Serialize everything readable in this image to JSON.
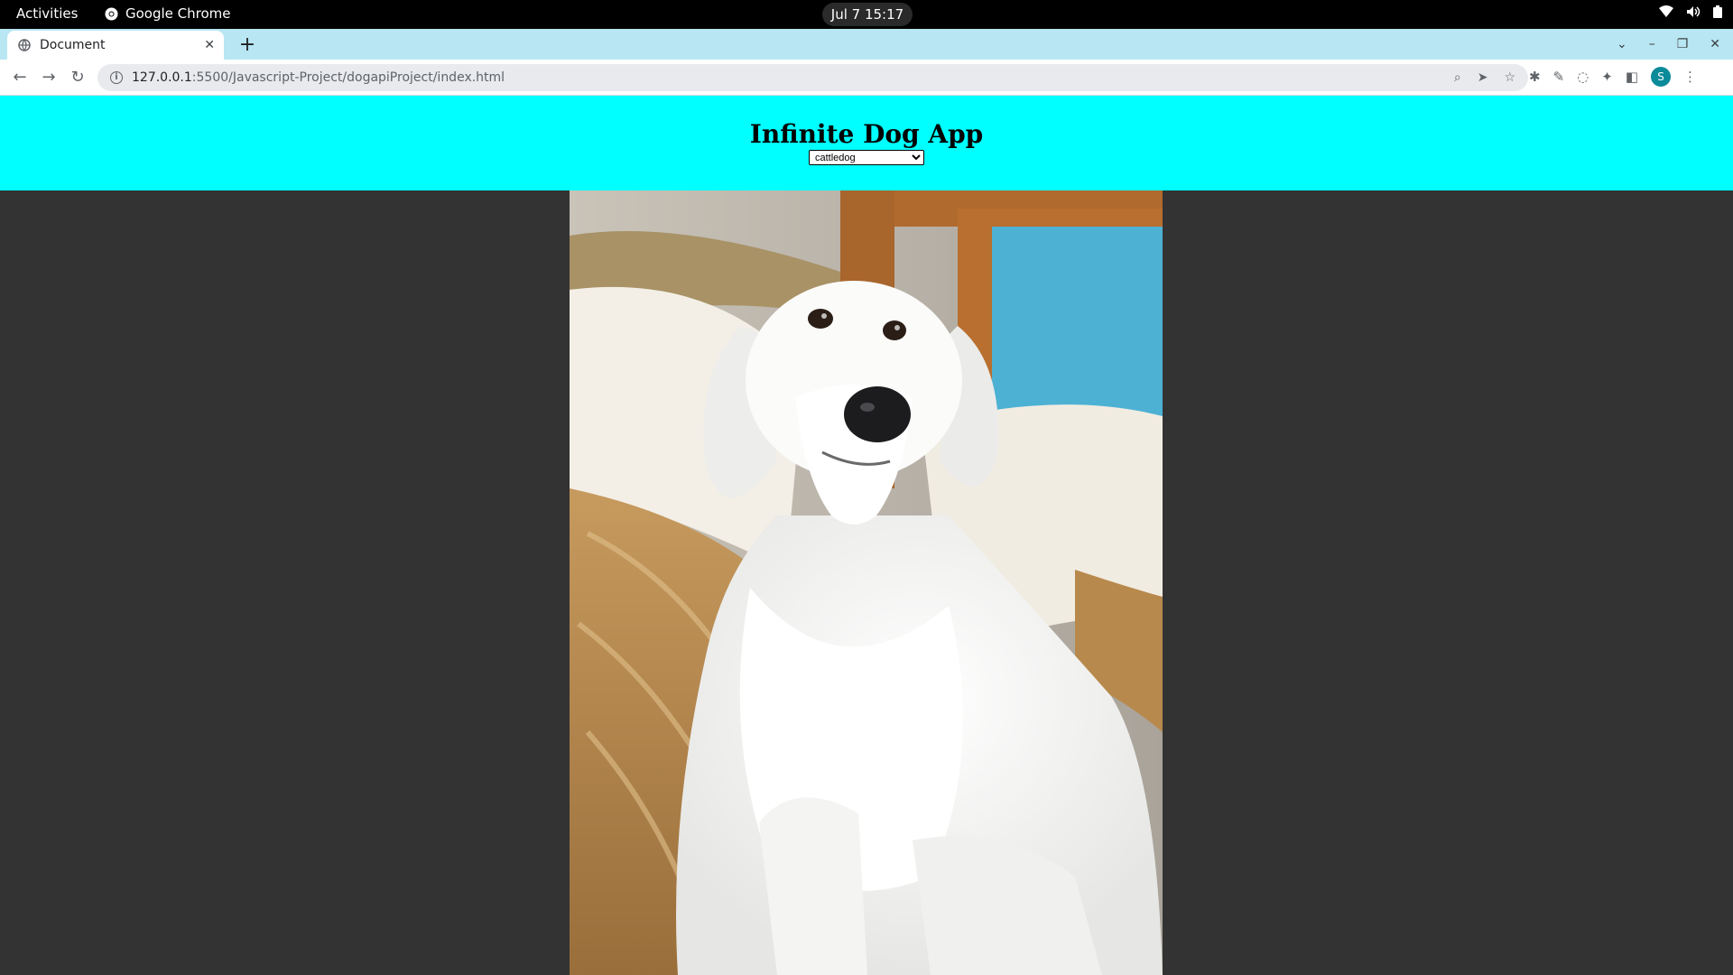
{
  "system_bar": {
    "activities": "Activities",
    "app_name": "Google Chrome",
    "clock": "Jul 7  15:17"
  },
  "browser": {
    "tab_title": "Document",
    "url_host": "127.0.0.1",
    "url_path": ":5500/Javascript-Project/dogapiProject/index.html"
  },
  "app": {
    "title": "Infinite Dog App",
    "breed_select": {
      "selected": "cattledog"
    },
    "colors": {
      "header_bg": "#00ffff",
      "page_bg": "#333333"
    }
  },
  "avatar_letter": "S"
}
